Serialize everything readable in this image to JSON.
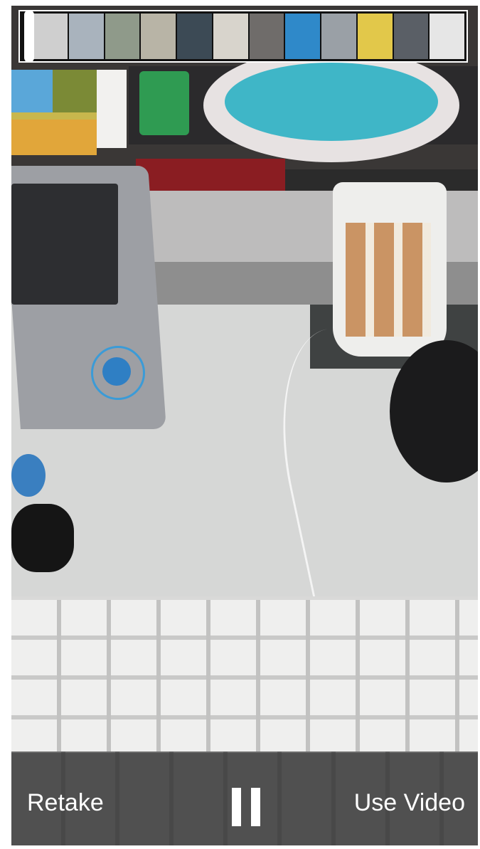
{
  "controls": {
    "retake_label": "Retake",
    "use_label": "Use Video",
    "pause_icon": "pause-icon"
  },
  "scrubber": {
    "thumbnail_colors": [
      "#cfcfcf",
      "#a9b3bd",
      "#8f9a8a",
      "#b8b4a6",
      "#3c4a55",
      "#d8d4cc",
      "#6f6c6a",
      "#2f89c9",
      "#9aa0a6",
      "#e2c84a",
      "#5a5f66",
      "#e6e6e6"
    ]
  },
  "colors": {
    "control_bar": "#3a3a3a",
    "text": "#ffffff"
  }
}
